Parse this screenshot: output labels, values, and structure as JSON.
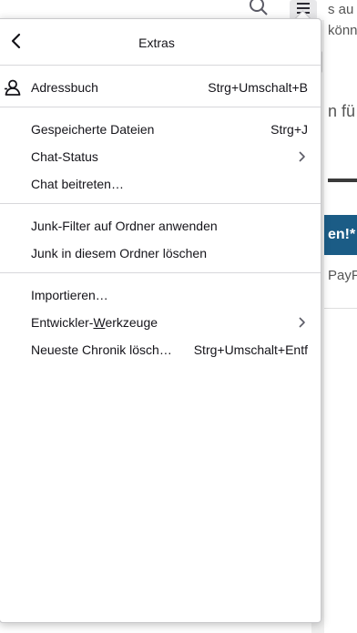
{
  "background": {
    "text_lines": [
      "s au",
      "könn",
      "n fü",
      "PayP"
    ],
    "banner_text": "en!*"
  },
  "panel": {
    "title": "Extras",
    "items": [
      {
        "label": "Adressbuch",
        "shortcut": "Strg+Umschalt+B",
        "icon": "address-book-icon"
      },
      {
        "label": "Gespeicherte Dateien",
        "shortcut": "Strg+J"
      },
      {
        "label": "Chat-Status",
        "submenu": true
      },
      {
        "label": "Chat beitreten…"
      },
      {
        "label": "Junk-Filter auf Ordner anwenden"
      },
      {
        "label": "Junk in diesem Ordner löschen"
      },
      {
        "label": "Importieren…"
      },
      {
        "label_pre": "Entwickler-",
        "label_accel": "W",
        "label_post": "erkzeuge",
        "submenu": true
      },
      {
        "label": "Neueste Chronik lösch…",
        "shortcut": "Strg+Umschalt+Entf"
      }
    ]
  },
  "colors": {
    "text": "#15141a",
    "separator": "#d7d7db",
    "banner": "#1b5c86"
  }
}
